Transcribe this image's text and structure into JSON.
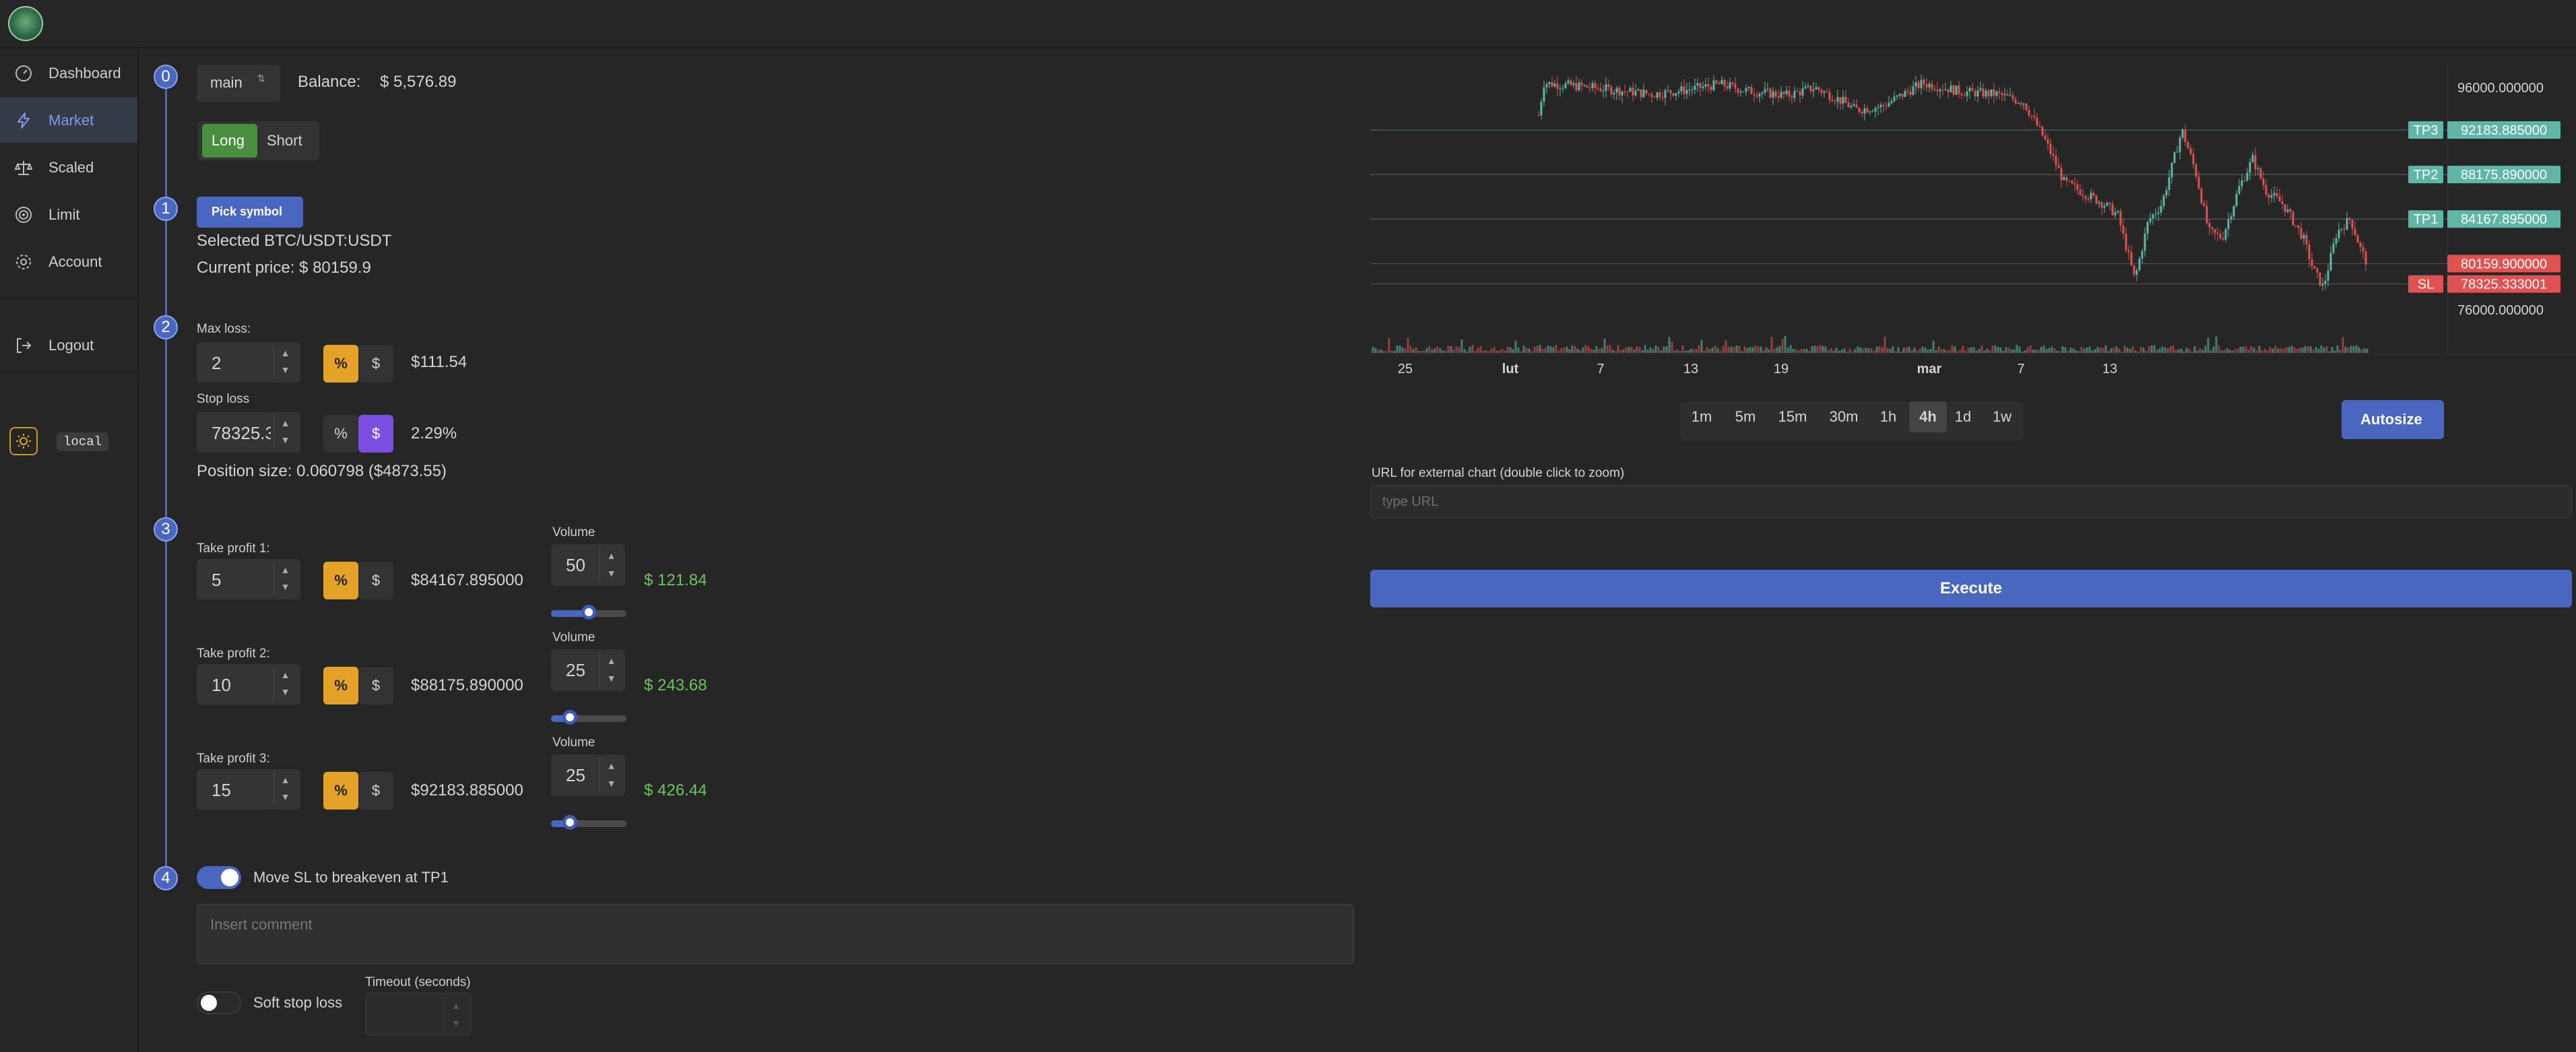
{
  "nav": {
    "items": [
      {
        "label": "Dashboard",
        "icon": "dashboard-icon"
      },
      {
        "label": "Market",
        "icon": "lightning-icon"
      },
      {
        "label": "Scaled",
        "icon": "scales-icon"
      },
      {
        "label": "Limit",
        "icon": "target-icon"
      },
      {
        "label": "Account",
        "icon": "gear-icon"
      },
      {
        "label": "Logout",
        "icon": "logout-icon"
      }
    ],
    "active": "Market",
    "env_badge": "local"
  },
  "form": {
    "steps": [
      "0",
      "1",
      "2",
      "3",
      "4"
    ],
    "account_select": "main",
    "balance_label": "Balance:",
    "balance_value": "$ 5,576.89",
    "side": {
      "long": "Long",
      "short": "Short",
      "selected": "Long"
    },
    "pick_symbol": "Pick symbol",
    "selected_symbol": "Selected BTC/USDT:USDT",
    "current_price": "Current price: $ 80159.9",
    "max_loss": {
      "label": "Max loss:",
      "value": "2",
      "pct": "%",
      "usd": "$",
      "result": "$111.54"
    },
    "stop_loss": {
      "label": "Stop loss",
      "value": "78325.3",
      "pct": "%",
      "usd": "$",
      "result": "2.29%"
    },
    "position_size": "Position size: 0.060798 ($4873.55)",
    "take_profits": [
      {
        "label": "Take profit 1:",
        "value": "5",
        "price": "$84167.895000",
        "volume_label": "Volume",
        "volume": "50",
        "volume_pct": 0.5,
        "amount": "$ 121.84"
      },
      {
        "label": "Take profit 2:",
        "value": "10",
        "price": "$88175.890000",
        "volume_label": "Volume",
        "volume": "25",
        "volume_pct": 0.25,
        "amount": "$ 243.68"
      },
      {
        "label": "Take profit 3:",
        "value": "15",
        "price": "$92183.885000",
        "volume_label": "Volume",
        "volume": "25",
        "volume_pct": 0.25,
        "amount": "$ 426.44"
      }
    ],
    "breakeven_label": "Move SL to breakeven at TP1",
    "comment_placeholder": "Insert comment",
    "soft_sl_label": "Soft stop loss",
    "timeout_label": "Timeout (seconds)"
  },
  "chart": {
    "price_ticks": [
      "96000.000000",
      "76000.000000"
    ],
    "lines": [
      {
        "tag": "TP3",
        "value": "92183.885000",
        "color": "#5fb5a6"
      },
      {
        "tag": "TP2",
        "value": "88175.890000",
        "color": "#5fb5a6"
      },
      {
        "tag": "TP1",
        "value": "84167.895000",
        "color": "#5fb5a6"
      },
      {
        "tag": "",
        "value": "80159.900000",
        "color": "#e05252"
      },
      {
        "tag": "SL",
        "value": "78325.333001",
        "color": "#e05252"
      }
    ],
    "time_labels": [
      "25",
      "lut",
      "7",
      "13",
      "19",
      "mar",
      "7",
      "13"
    ],
    "timeframes": [
      "1m",
      "5m",
      "15m",
      "30m",
      "1h",
      "4h",
      "1d",
      "1w"
    ],
    "timeframe_selected": "4h",
    "autosize": "Autosize",
    "url_label": "URL for external chart (double click to zoom)",
    "url_placeholder": "type URL",
    "execute": "Execute"
  }
}
